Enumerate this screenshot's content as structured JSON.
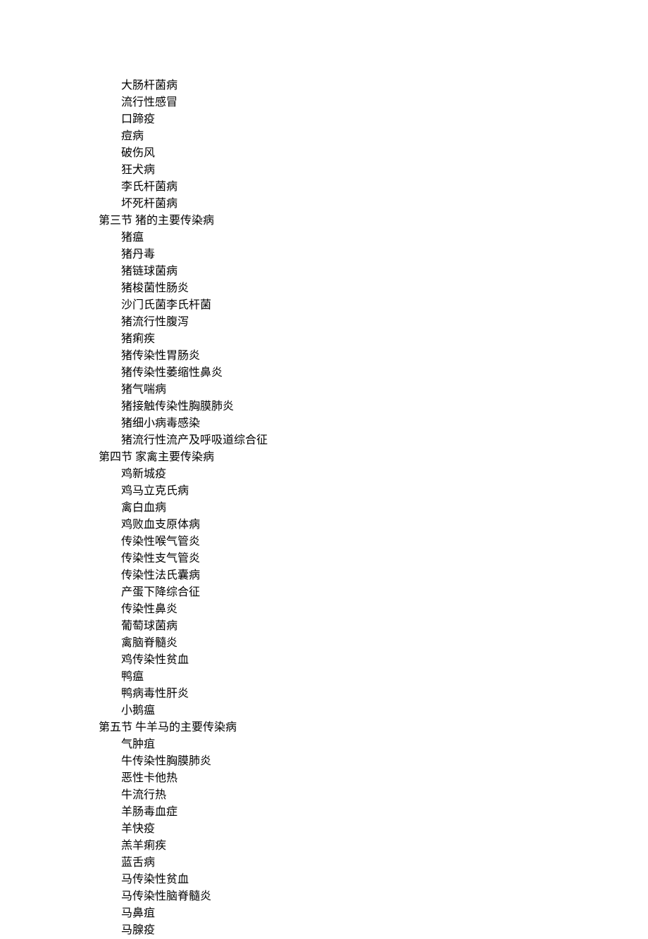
{
  "content": {
    "intro_items": [
      "大肠杆菌病",
      "流行性感冒",
      "口蹄疫",
      "痘病",
      "破伤风",
      "狂犬病",
      "李氏杆菌病",
      "坏死杆菌病"
    ],
    "section3_title": "第三节  猪的主要传染病",
    "section3_items": [
      "猪瘟",
      "猪丹毒",
      "猪链球菌病",
      "猪梭菌性肠炎",
      "沙门氏菌李氏杆菌",
      "猪流行性腹泻",
      "猪痢疾",
      "猪传染性胃肠炎",
      "猪传染性萎缩性鼻炎",
      "猪气喘病",
      "猪接触传染性胸膜肺炎",
      "猪细小病毒感染",
      "猪流行性流产及呼吸道综合征"
    ],
    "section4_title": "第四节  家禽主要传染病",
    "section4_items": [
      "鸡新城疫",
      "鸡马立克氏病",
      "禽白血病",
      "鸡败血支原体病",
      "传染性喉气管炎",
      "传染性支气管炎",
      "传染性法氏囊病",
      "产蛋下降综合征",
      "传染性鼻炎",
      "葡萄球菌病",
      "禽脑脊髓炎",
      "鸡传染性贫血",
      "鸭瘟",
      "鸭病毒性肝炎",
      "小鹅瘟"
    ],
    "section5_title": "第五节    牛羊马的主要传染病",
    "section5_items": [
      "气肿疽",
      "牛传染性胸膜肺炎",
      "恶性卡他热",
      "牛流行热",
      "羊肠毒血症",
      "羊快疫",
      "羔羊痢疾",
      "蓝舌病",
      "马传染性贫血",
      "马传染性脑脊髓炎",
      "马鼻疽",
      "马腺疫"
    ]
  }
}
